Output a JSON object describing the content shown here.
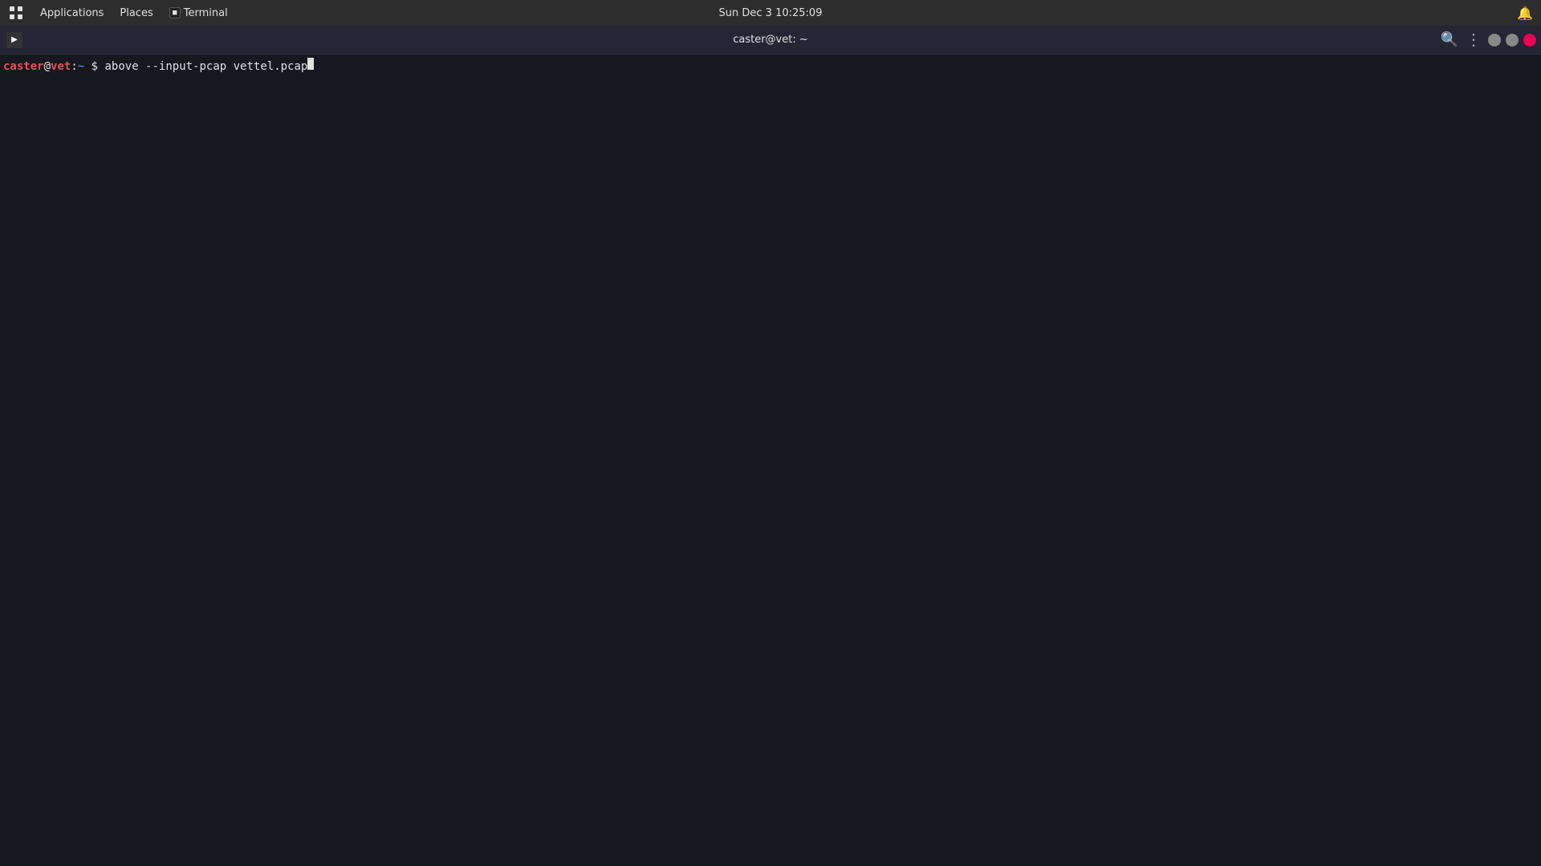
{
  "systemBar": {
    "appsLabel": "Applications",
    "placesLabel": "Places",
    "terminalLabel": "Terminal",
    "datetime": "Sun Dec 3  10:25:09",
    "titleCenter": "caster@vet: ~"
  },
  "terminal": {
    "title": "caster@vet: ~",
    "prompt": {
      "user": "caster",
      "at": "@",
      "host": "vet",
      "colon": ":",
      "tilde": "~",
      "dollar": "$"
    },
    "command": "above --input-pcap vettel.pcap",
    "buttons": {
      "search": "🔍",
      "menu": "⋮",
      "minimize": "",
      "maximize": "",
      "close": ""
    }
  }
}
